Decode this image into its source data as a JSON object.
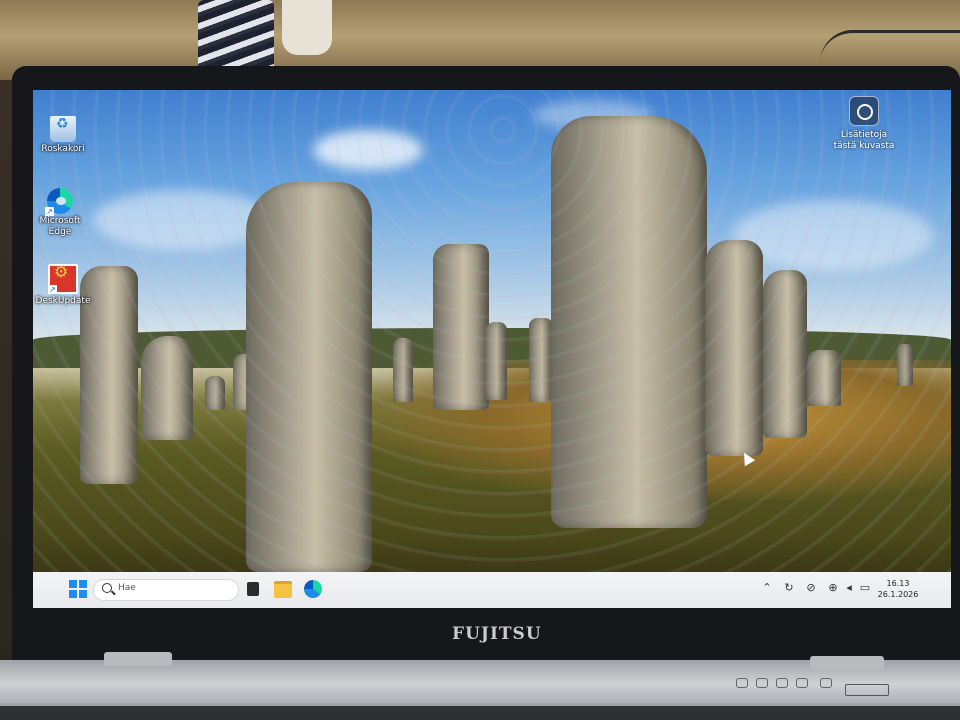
{
  "desktop": {
    "icons": [
      {
        "label": "Roskakori",
        "icon": "recycle-bin-icon"
      },
      {
        "label": "Microsoft Edge",
        "icon": "edge-icon"
      },
      {
        "label": "DeskUpdate",
        "icon": "deskupdate-icon"
      }
    ],
    "spotlight": {
      "label": "Lisätietoja tästä kuvasta",
      "icon": "spotlight-icon"
    }
  },
  "taskbar": {
    "search_placeholder": "Hae",
    "pinned": [
      {
        "name": "task-view",
        "icon": "task-view-icon"
      },
      {
        "name": "file-explorer",
        "icon": "folder-icon"
      },
      {
        "name": "edge",
        "icon": "edge-icon"
      }
    ],
    "tray": [
      "chevron-up-icon",
      "copilot-icon",
      "camera-off-icon",
      "network-icon",
      "volume-icon",
      "battery-icon"
    ],
    "clock": {
      "time": "16.13",
      "date": "26.1.2026"
    }
  },
  "laptop": {
    "brand": "FUJITSU"
  },
  "colors": {
    "accent": "#1e8cf0",
    "taskbar": "#f0f1f4"
  }
}
